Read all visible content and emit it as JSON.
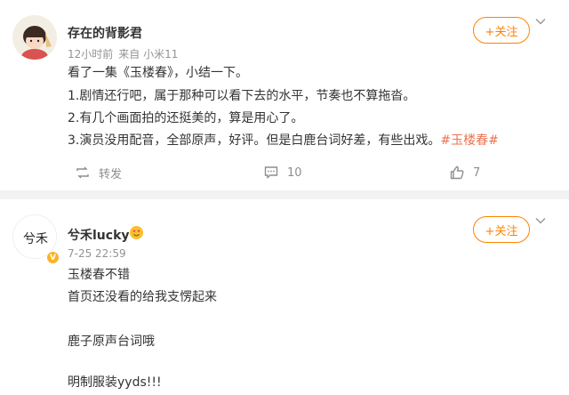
{
  "post1": {
    "username": "存在的背影君",
    "time": "12小时前",
    "source": "来自 小米11",
    "follow_label": "+关注",
    "lines": [
      "看了一集《玉楼春》，小结一下。",
      "1.剧情还行吧，属于那种可以看下去的水平，节奏也不算拖沓。",
      "2.有几个画面拍的还挺美的，算是用心了。",
      "3.演员没用配音，全部原声，好评。但是白鹿台词好差，有些出戏。"
    ],
    "topic": "#玉楼春#",
    "repost_label": "转发",
    "comment_count": "10",
    "like_count": "7"
  },
  "post2": {
    "username": "兮禾lucky",
    "time": "7-25 22:59",
    "follow_label": "+关注",
    "avatar_text": "兮禾",
    "lines": [
      "玉楼春不错",
      "首页还没看的给我支愣起来",
      "鹿子原声台词哦",
      "明制服装yyds!!!"
    ]
  },
  "icons": {
    "repost": "repost-icon",
    "comment": "comment-icon",
    "like": "like-icon",
    "chevron": "chevron-down-icon",
    "verified": "verified-badge-icon",
    "member": "member-emoji-icon"
  },
  "colors": {
    "accent": "#ff8200",
    "topic": "#eb7350",
    "meta": "#939393",
    "badge": "#fbb324"
  }
}
